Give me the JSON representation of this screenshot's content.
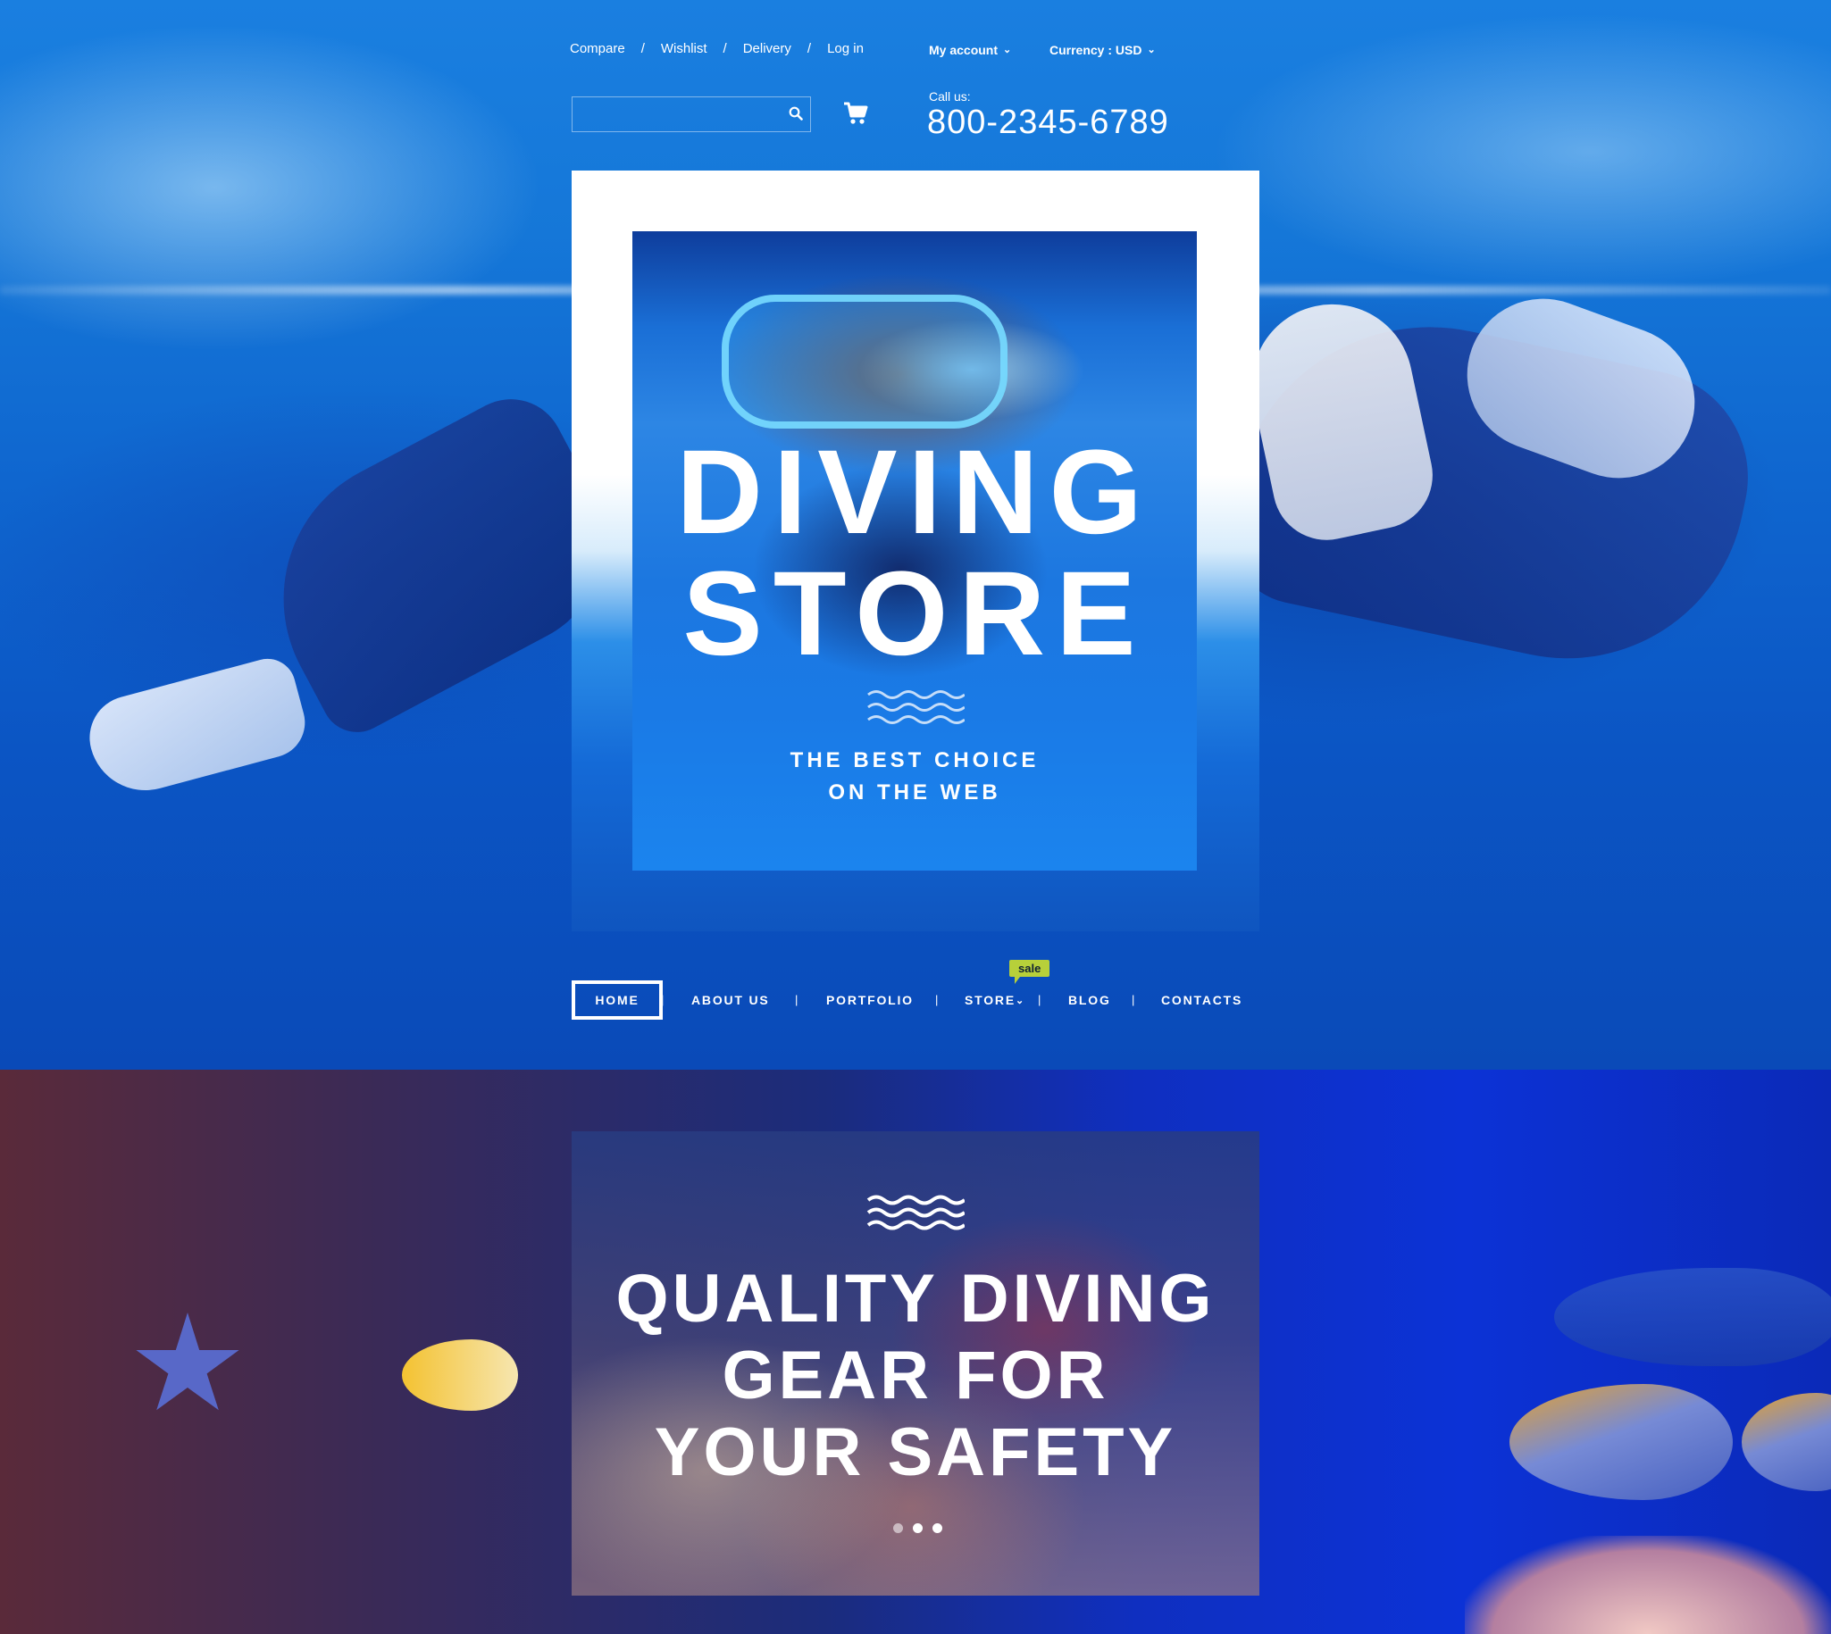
{
  "top_links": [
    {
      "label": "Compare"
    },
    {
      "label": "Wishlist"
    },
    {
      "label": "Delivery"
    },
    {
      "label": "Log in"
    }
  ],
  "top_links_separator": "/",
  "account": {
    "label": "My account"
  },
  "currency": {
    "label": "Currency : USD"
  },
  "search": {
    "placeholder": "",
    "value": ""
  },
  "contact": {
    "call_label": "Call us:",
    "phone": "800-2345-6789"
  },
  "hero": {
    "title_line1": "DIVING",
    "title_line2": "STORE",
    "subtitle_line1": "THE BEST CHOICE",
    "subtitle_line2": "ON THE WEB"
  },
  "nav": {
    "items": [
      {
        "label": "HOME",
        "active": true
      },
      {
        "label": "ABOUT US"
      },
      {
        "label": "PORTFOLIO"
      },
      {
        "label": "STORE",
        "badge": "sale"
      },
      {
        "label": "BLOG"
      },
      {
        "label": "CONTACTS"
      }
    ],
    "separator": "|"
  },
  "promo": {
    "title_line1": "QUALITY DIVING",
    "title_line2": "GEAR FOR",
    "title_line3": "YOUR SAFETY",
    "slides_total": 3,
    "slide_active": 2
  },
  "colors": {
    "sale_badge": "#b7d03a",
    "ocean_blue": "#1577d8"
  },
  "icons": [
    "search-icon",
    "cart-icon",
    "chevron-down-icon",
    "waves-icon"
  ]
}
